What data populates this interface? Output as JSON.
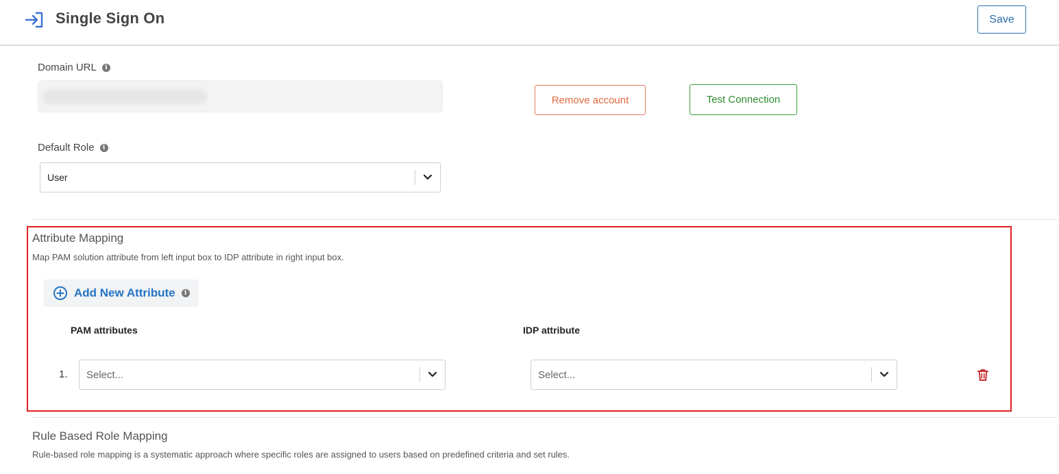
{
  "header": {
    "icon": "sign-in-icon",
    "title": "Single Sign On",
    "save_label": "Save"
  },
  "domain": {
    "label": "Domain URL",
    "info_icon": "info-icon",
    "value_redacted": true
  },
  "actions": {
    "remove_label": "Remove account",
    "test_label": "Test Connection"
  },
  "default_role": {
    "label": "Default Role",
    "value": "User"
  },
  "attribute_mapping": {
    "title": "Attribute Mapping",
    "description": "Map PAM solution attribute from left input box to IDP attribute in right input box.",
    "add_label": "Add New Attribute",
    "columns": {
      "pam": "PAM attributes",
      "idp": "IDP attribute"
    },
    "rows": [
      {
        "number": "1.",
        "pam_placeholder": "Select...",
        "idp_placeholder": "Select..."
      }
    ]
  },
  "rule_mapping": {
    "title": "Rule Based Role Mapping",
    "description": "Rule-based role mapping is a systematic approach where specific roles are assigned to users based on predefined criteria and set rules."
  },
  "colors": {
    "accent_blue": "#2574c4",
    "danger": "#e0693f",
    "success": "#2e8b2e",
    "highlight": "#e02020",
    "trash": "#c62828"
  }
}
